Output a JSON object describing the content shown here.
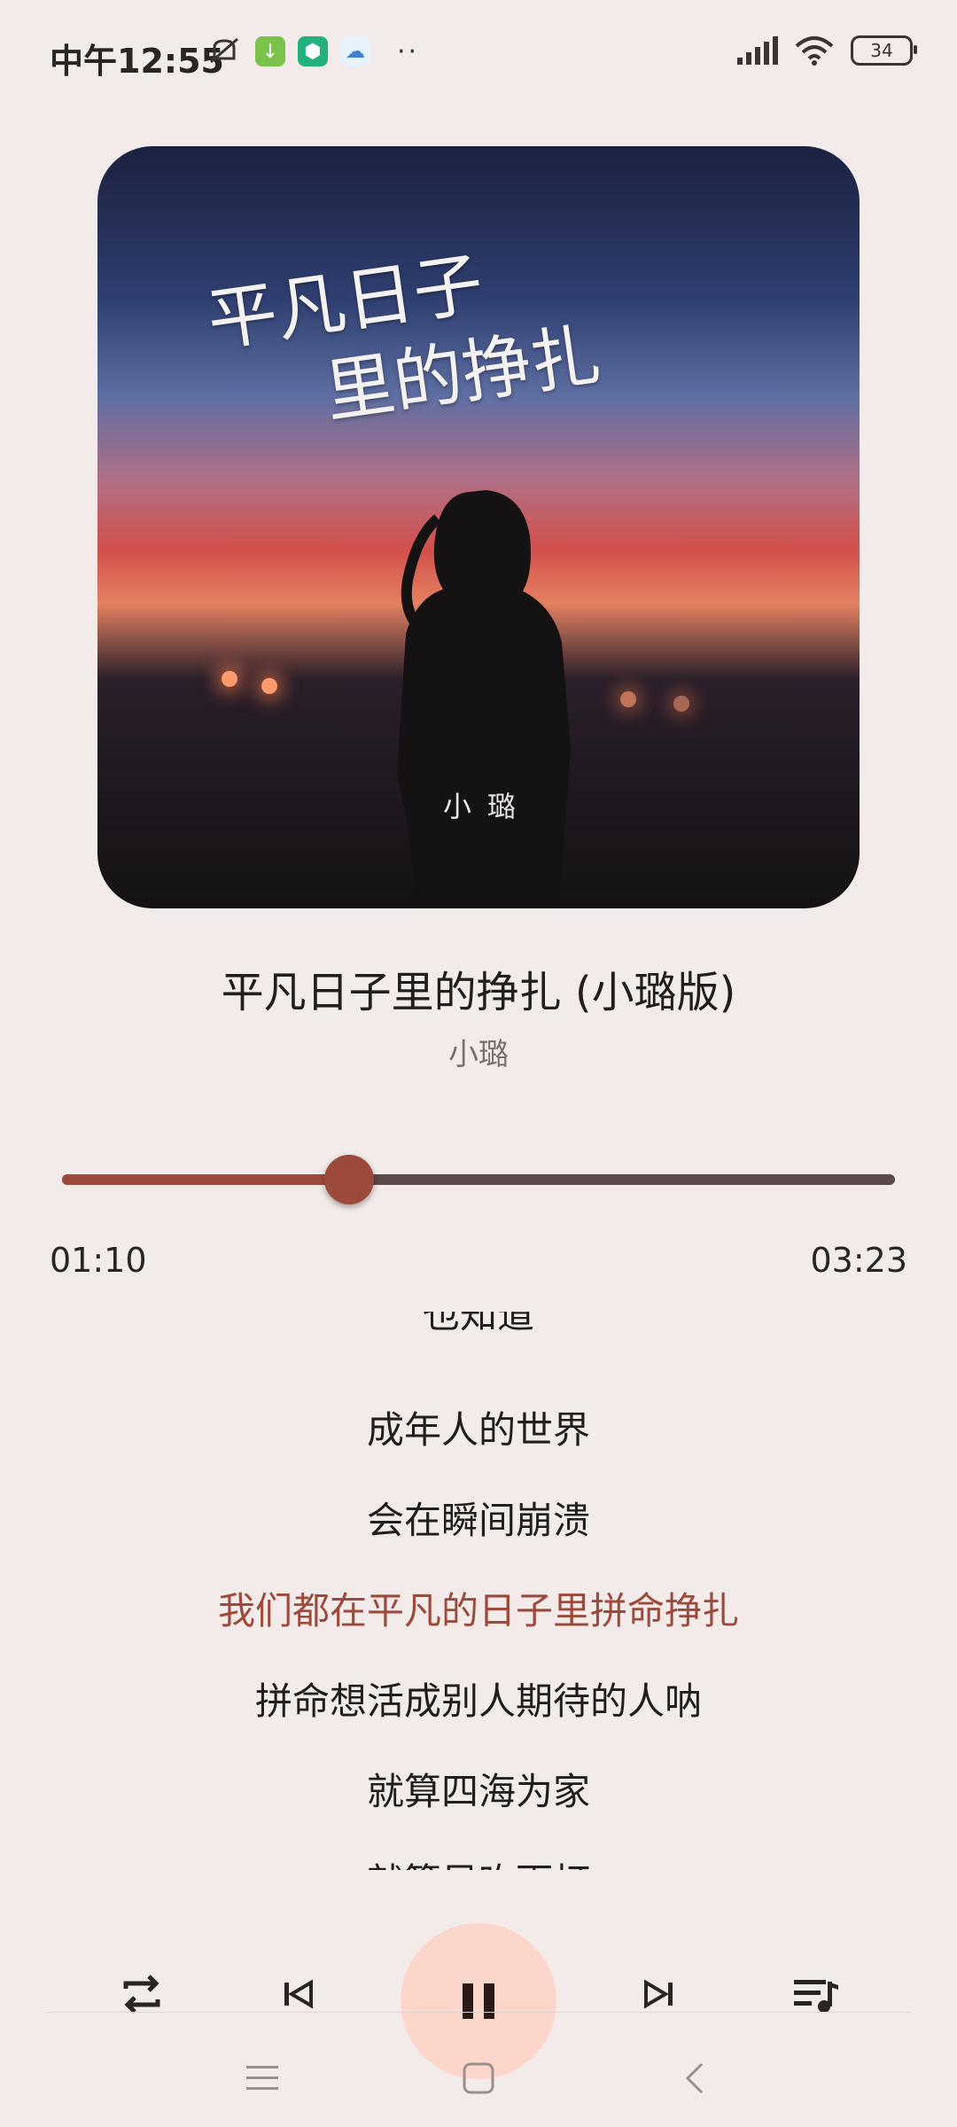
{
  "status_bar": {
    "time": "中午12:55",
    "battery": "34",
    "icons": [
      "mute-icon",
      "download-app-icon",
      "shield-app-icon",
      "cloud-app-icon",
      "more-icon",
      "signal-icon",
      "wifi-icon",
      "battery-icon"
    ]
  },
  "album": {
    "art_title_line1": "平凡日子",
    "art_title_line2": "里的挣扎",
    "art_artist": "小璐"
  },
  "song": {
    "title": "平凡日子里的挣扎 (小璐版)",
    "artist": "小璐"
  },
  "playback": {
    "current_time": "01:10",
    "total_time": "03:23",
    "progress_fraction": 0.345
  },
  "lyrics": {
    "lines": [
      "也知道",
      "成年人的世界",
      "会在瞬间崩溃",
      "我们都在平凡的日子里拼命挣扎",
      "拼命想活成别人期待的人呐",
      "就算四海为家",
      "就算风吹雨打"
    ],
    "active_index": 3
  },
  "colors": {
    "background": "#f3ebe9",
    "accent": "#9c4a3c",
    "play_button_bg": "#fdd6cb",
    "track": "#5a4a49"
  },
  "controls": [
    "repeat-icon",
    "previous-icon",
    "pause-icon",
    "next-icon",
    "playlist-icon"
  ],
  "nav": [
    "menu-icon",
    "home-icon",
    "back-icon"
  ]
}
